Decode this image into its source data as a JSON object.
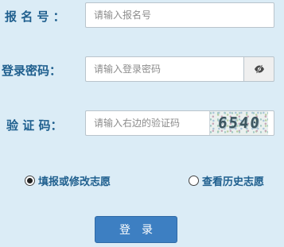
{
  "form": {
    "registration_number": {
      "label": "报 名 号 ：",
      "placeholder": "请输入报名号",
      "value": ""
    },
    "password": {
      "label": "登录密码：",
      "placeholder": "请输入登录密码",
      "value": "",
      "toggle_icon": "eye-slash-icon"
    },
    "captcha": {
      "label": "验 证 码：",
      "placeholder": "请输入右边的验证码",
      "value": "",
      "image_text": "6540"
    },
    "mode": {
      "options": [
        {
          "label": "填报或修改志愿",
          "selected": true
        },
        {
          "label": "查看历史志愿",
          "selected": false
        }
      ]
    },
    "submit_label": "登录"
  },
  "colors": {
    "background": "#dbecf6",
    "label_text": "#1f5f8e",
    "button": "#3d7fc2"
  }
}
